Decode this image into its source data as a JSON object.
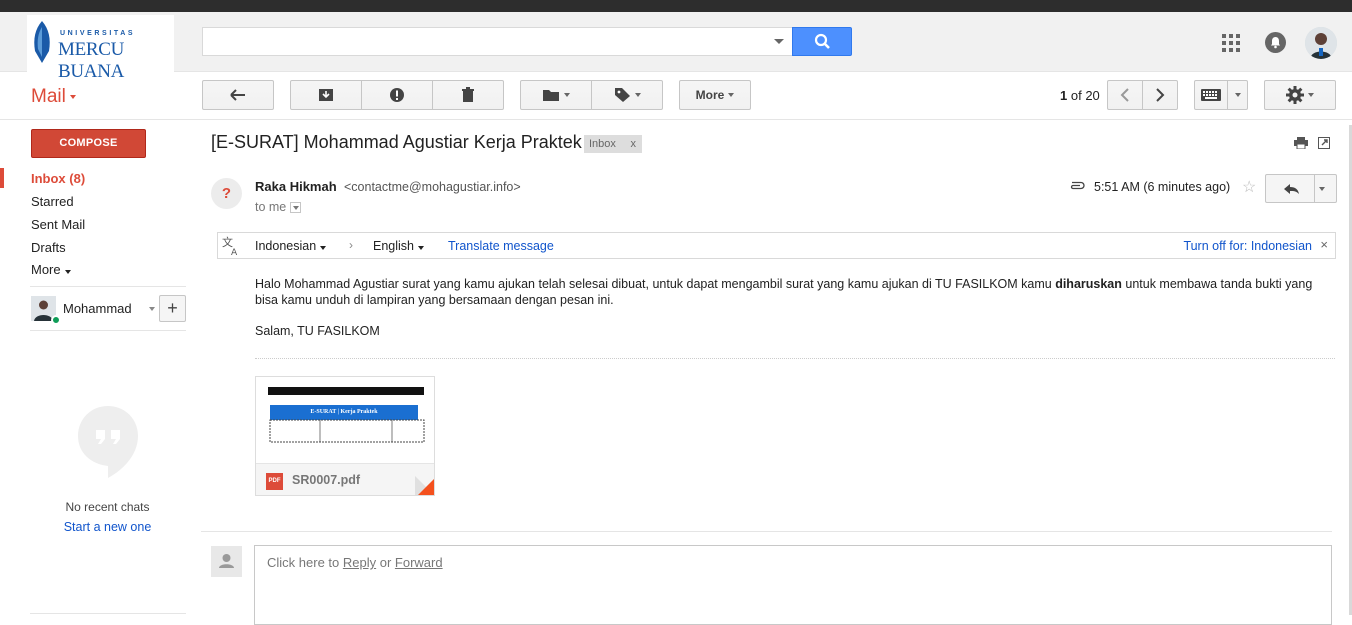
{
  "logo": {
    "sub": "UNIVERSITAS",
    "main": "MERCU BUANA"
  },
  "search": {
    "value": "",
    "placeholder": ""
  },
  "mail_label": "Mail",
  "toolbar": {
    "more_label": "More"
  },
  "pager": {
    "current": "1",
    "of_label": "of",
    "total": "20"
  },
  "compose_label": "COMPOSE",
  "nav": [
    {
      "label": "Inbox (8)"
    },
    {
      "label": "Starred"
    },
    {
      "label": "Sent Mail"
    },
    {
      "label": "Drafts"
    },
    {
      "label": "More"
    }
  ],
  "chat": {
    "user_name": "Mohammad",
    "plus": "+",
    "no_chats": "No recent chats",
    "start_new": "Start a new one"
  },
  "message": {
    "subject": "[E-SURAT] Mohammad Agustiar Kerja Praktek",
    "label_badge": "Inbox",
    "label_close": "x",
    "sender_initial": "?",
    "sender_name": "Raka Hikmah",
    "sender_email": "<contactme@mohagustiar.info>",
    "to": "to me",
    "time": "5:51 AM (6 minutes ago)",
    "star": "☆",
    "body_part1": "Halo Mohammad Agustiar surat yang kamu ajukan telah selesai dibuat, untuk dapat mengambil surat yang kamu ajukan di TU FASILKOM kamu ",
    "body_bold": "diharuskan",
    "body_part2": " untuk membawa tanda bukti yang bisa kamu unduh di lampiran yang bersamaan dengan pesan ini.",
    "salam": "Salam, TU FASILKOM"
  },
  "translate": {
    "from": "Indonesian",
    "arrow": "›",
    "to": "English",
    "link": "Translate message",
    "off": "Turn off for: Indonesian",
    "close": "×"
  },
  "attachment": {
    "name": "SR0007.pdf",
    "icon_label": "PDF",
    "preview_header": "E-SURAT | Kerja Praktek"
  },
  "reply": {
    "prefix": "Click here to ",
    "reply_link": "Reply",
    "middle": " or ",
    "forward_link": "Forward"
  }
}
